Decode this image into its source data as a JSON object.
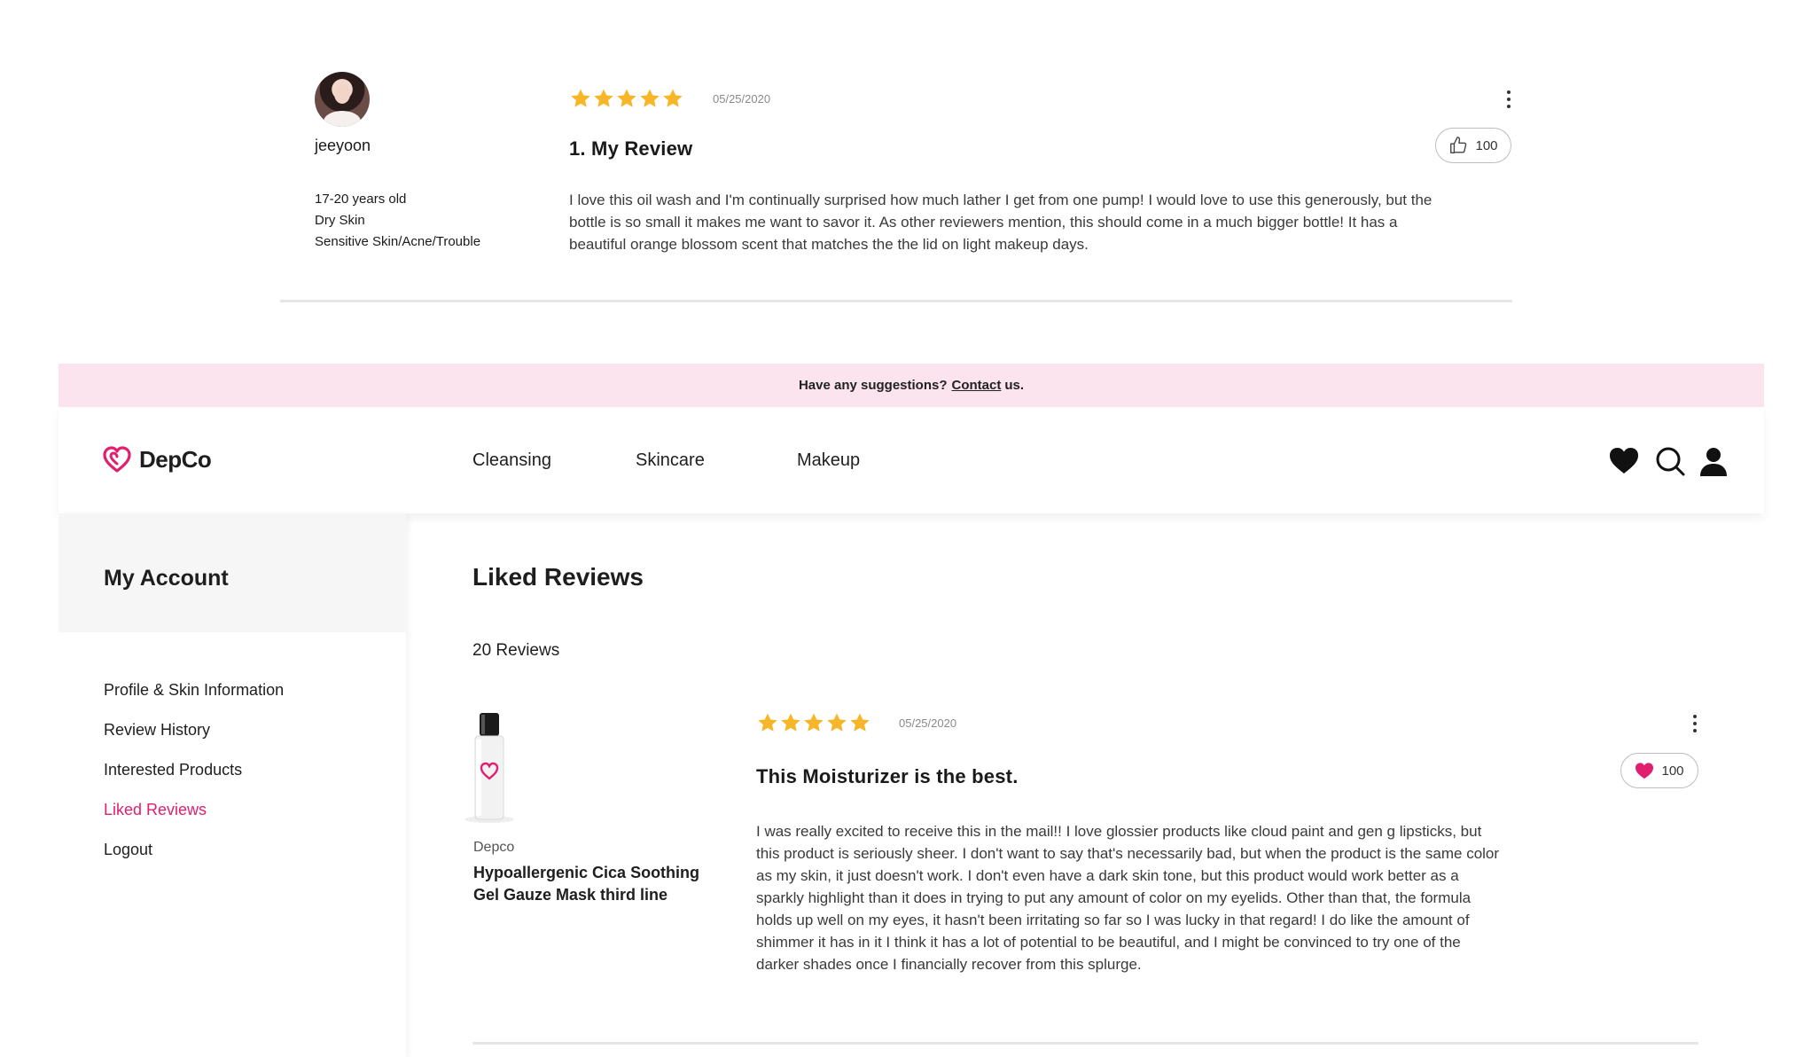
{
  "top_review": {
    "username": "jeeyoon",
    "age": "17-20 years old",
    "skin_type": "Dry Skin",
    "skin_concern": "Sensitive Skin/Acne/Trouble",
    "rating": 5,
    "date": "05/25/2020",
    "title": "1. My Review",
    "likes": "100",
    "body": "I love this oil wash and I'm continually surprised how much lather I get from one pump! I would love to use this generously, but the bottle is so small it makes me want to savor it. As other reviewers mention, this should come in a much bigger bottle! It has a beautiful orange blossom  scent that matches the the lid on light makeup days."
  },
  "banner": {
    "prefix": "Have any suggestions?",
    "link": "Contact",
    "suffix": "us."
  },
  "header": {
    "logo_text": "DepCo",
    "nav": [
      "Cleansing",
      "Skincare",
      "Makeup"
    ],
    "icons": [
      "heart-icon",
      "search-icon",
      "user-icon"
    ]
  },
  "sidebar": {
    "title": "My Account",
    "items": [
      {
        "label": "Profile & Skin Information",
        "active": false
      },
      {
        "label": "Review History",
        "active": false
      },
      {
        "label": "Interested Products",
        "active": false
      },
      {
        "label": "Liked Reviews",
        "active": true
      },
      {
        "label": "Logout",
        "active": false
      }
    ]
  },
  "main": {
    "title": "Liked Reviews",
    "count_label": "20 Reviews",
    "review": {
      "brand": "Depco",
      "product_name": "Hypoallergenic Cica Soothing Gel Gauze Mask third line",
      "rating": 5,
      "date": "05/25/2020",
      "title": "This Moisturizer is the best.",
      "likes": "100",
      "body": "I was really excited to receive this in the mail!! I love glossier products like cloud paint and gen g lipsticks, but this product is seriously sheer. I don't want to say that's necessarily bad, but when the product is the same color as my skin, it just doesn't work. I don't even have a dark skin tone, but this product would work better as a sparkly highlight than it does in trying to put any amount of color on my eyelids. Other than that, the formula holds up well on my eyes, it hasn't been irritating so far so I was lucky in that regard! I do like the amount of shimmer it has in it I think it has a lot of potential to be beautiful, and I might be convinced to try one of the darker shades once I financially recover from this splurge."
    }
  },
  "colors": {
    "accent": "#e0206e",
    "star": "#f6b628",
    "banner_bg": "#fbe4ee"
  }
}
